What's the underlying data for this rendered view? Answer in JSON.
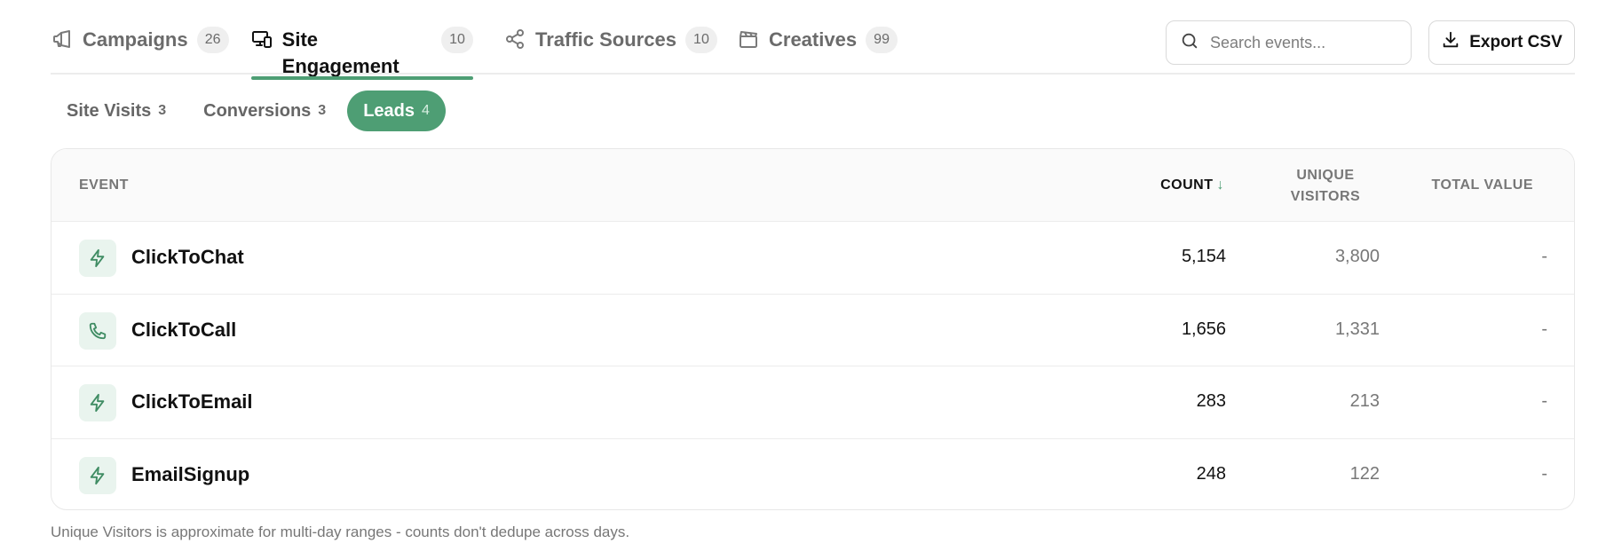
{
  "tabs": [
    {
      "label": "Campaigns",
      "badge": "26",
      "icon": "megaphone-icon"
    },
    {
      "label": "Site Engagement",
      "badge": "10",
      "icon": "devices-icon"
    },
    {
      "label": "Traffic Sources",
      "badge": "10",
      "icon": "share-icon"
    },
    {
      "label": "Creatives",
      "badge": "99",
      "icon": "clapperboard-icon"
    }
  ],
  "active_tab": "Site Engagement",
  "search": {
    "placeholder": "Search events...",
    "value": ""
  },
  "export": {
    "label": "Export CSV"
  },
  "subtabs": [
    {
      "label": "Site Visits",
      "count": "3"
    },
    {
      "label": "Conversions",
      "count": "3"
    },
    {
      "label": "Leads",
      "count": "4"
    }
  ],
  "active_subtab": "Leads",
  "table": {
    "headers": {
      "event": "EVENT",
      "count": "COUNT",
      "sort_arrow": "↓",
      "unique_visitors_line1": "UNIQUE",
      "unique_visitors_line2": "VISITORS",
      "total_value": "TOTAL VALUE"
    },
    "rows": [
      {
        "icon": "lightning-icon",
        "event": "ClickToChat",
        "count": "5,154",
        "unique_visitors": "3,800",
        "total_value": "-"
      },
      {
        "icon": "phone-icon",
        "event": "ClickToCall",
        "count": "1,656",
        "unique_visitors": "1,331",
        "total_value": "-"
      },
      {
        "icon": "lightning-icon",
        "event": "ClickToEmail",
        "count": "283",
        "unique_visitors": "213",
        "total_value": "-"
      },
      {
        "icon": "lightning-icon",
        "event": "EmailSignup",
        "count": "248",
        "unique_visitors": "122",
        "total_value": "-"
      }
    ]
  },
  "footnote": "Unique Visitors is approximate for multi-day ranges - counts don't dedupe across days.",
  "colors": {
    "accent": "#4e9e74",
    "icon_bg": "#e9f4ee",
    "badge_bg": "#efefef"
  }
}
